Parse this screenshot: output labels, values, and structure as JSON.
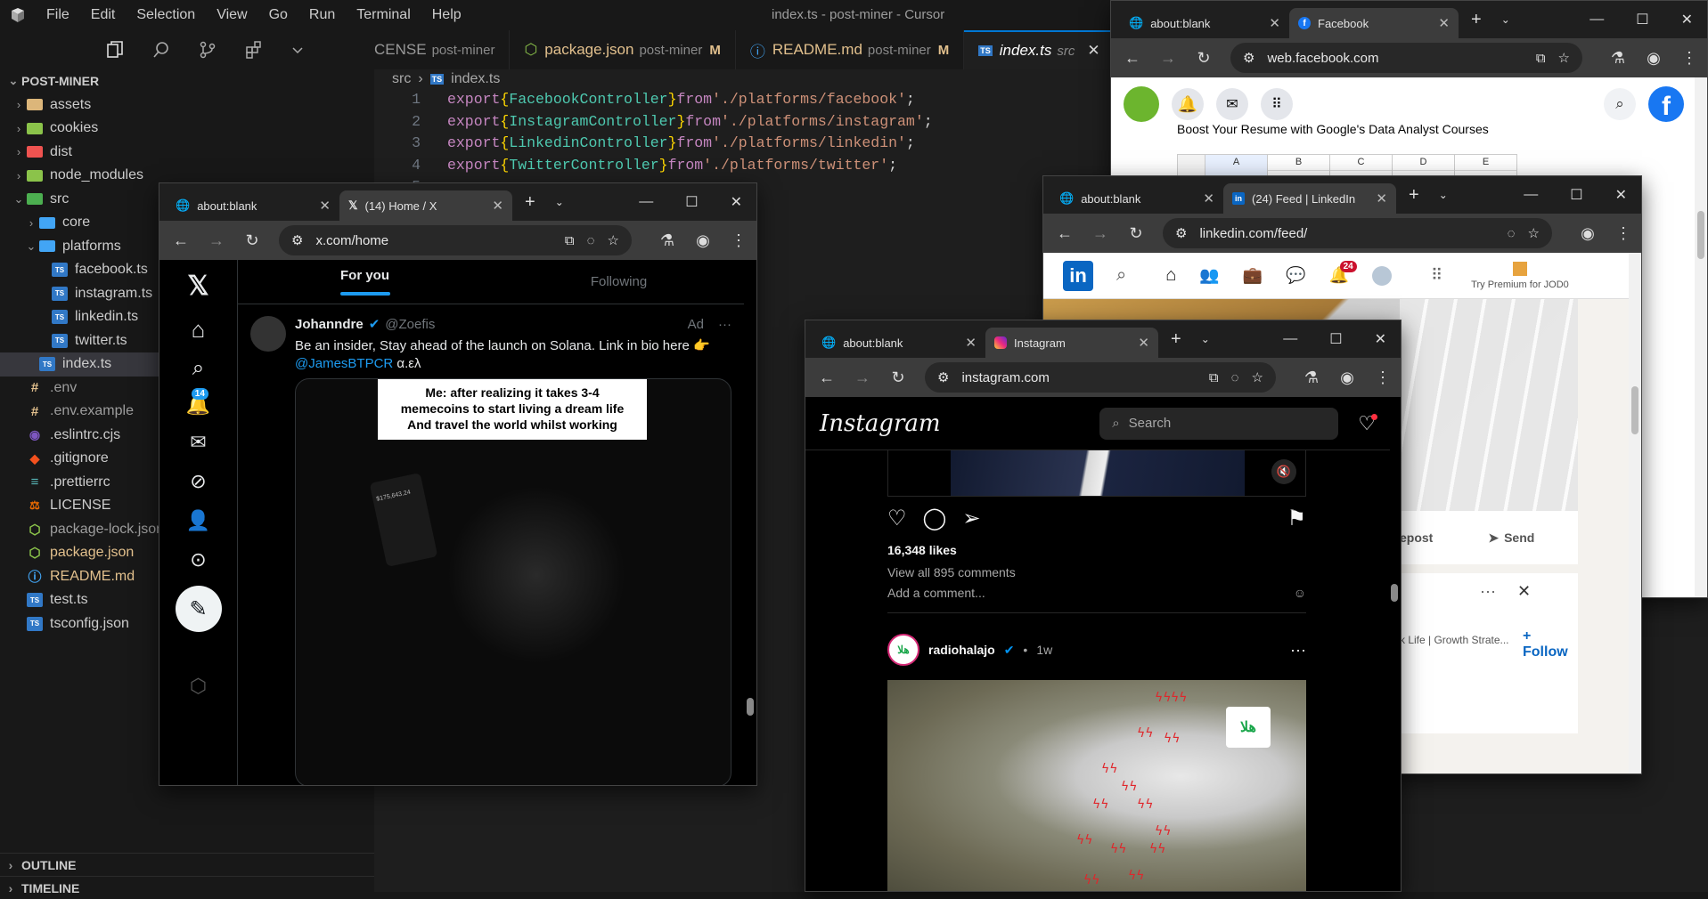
{
  "editor": {
    "menu": [
      "File",
      "Edit",
      "Selection",
      "View",
      "Go",
      "Run",
      "Terminal",
      "Help"
    ],
    "window_title": "index.ts - post-miner - Cursor",
    "explorer_title": "POST-MINER",
    "tree": [
      {
        "label": "assets",
        "type": "folder",
        "color": "#dcb67a",
        "depth": 1
      },
      {
        "label": "cookies",
        "type": "folder",
        "color": "#8bc34a",
        "depth": 1
      },
      {
        "label": "dist",
        "type": "folder",
        "color": "#ef5350",
        "depth": 1
      },
      {
        "label": "node_modules",
        "type": "folder",
        "color": "#8bc34a",
        "depth": 1
      },
      {
        "label": "src",
        "type": "folder-open",
        "color": "#4caf50",
        "depth": 1
      },
      {
        "label": "core",
        "type": "folder",
        "color": "#42a5f5",
        "depth": 2
      },
      {
        "label": "platforms",
        "type": "folder-open",
        "color": "#42a5f5",
        "depth": 2
      },
      {
        "label": "facebook.ts",
        "type": "ts",
        "depth": 3
      },
      {
        "label": "instagram.ts",
        "type": "ts",
        "depth": 3
      },
      {
        "label": "linkedin.ts",
        "type": "ts",
        "depth": 3
      },
      {
        "label": "twitter.ts",
        "type": "ts",
        "depth": 3
      },
      {
        "label": "index.ts",
        "type": "ts",
        "depth": 2,
        "selected": true
      },
      {
        "label": ".env",
        "type": "env",
        "depth": 1
      },
      {
        "label": ".env.example",
        "type": "env",
        "depth": 1
      },
      {
        "label": ".eslintrc.cjs",
        "type": "eslint",
        "depth": 1
      },
      {
        "label": ".gitignore",
        "type": "git",
        "depth": 1
      },
      {
        "label": ".prettierrc",
        "type": "prettier",
        "depth": 1
      },
      {
        "label": "LICENSE",
        "type": "license",
        "depth": 1
      },
      {
        "label": "package-lock.json",
        "type": "npm-dim",
        "depth": 1
      },
      {
        "label": "package.json",
        "type": "npm",
        "depth": 1
      },
      {
        "label": "README.md",
        "type": "info",
        "depth": 1
      },
      {
        "label": "test.ts",
        "type": "ts",
        "depth": 1
      },
      {
        "label": "tsconfig.json",
        "type": "tsconfig",
        "depth": 1
      }
    ],
    "outline_label": "OUTLINE",
    "timeline_label": "TIMELINE",
    "tabs": [
      {
        "name": "CENSE",
        "desc": "post-miner",
        "mod": ""
      },
      {
        "name": "package.json",
        "desc": "post-miner",
        "mod": "M"
      },
      {
        "name": "README.md",
        "desc": "post-miner",
        "mod": "M"
      },
      {
        "name": "index.ts",
        "desc": "src",
        "mod": "",
        "active": true
      }
    ],
    "breadcrumb": [
      "src",
      "index.ts"
    ],
    "code": [
      {
        "n": "1",
        "name": "FacebookController",
        "path": "'./platforms/facebook'"
      },
      {
        "n": "2",
        "name": "InstagramController",
        "path": "'./platforms/instagram'"
      },
      {
        "n": "3",
        "name": "LinkedinController",
        "path": "'./platforms/linkedin'"
      },
      {
        "n": "4",
        "name": "TwitterController",
        "path": "'./platforms/twitter'"
      },
      {
        "n": "5",
        "name": "",
        "path": ""
      }
    ],
    "kw_export": "export",
    "kw_from": "from"
  },
  "facebook": {
    "tab1": "about:blank",
    "tab2": "Facebook",
    "url": "web.facebook.com",
    "ad_text": "Boost Your Resume with Google's Data Analyst Courses",
    "sheet_cols": [
      "A",
      "B",
      "C",
      "D",
      "E"
    ]
  },
  "linkedin": {
    "tab1": "about:blank",
    "tab2": "(24) Feed | LinkedIn",
    "url": "linkedin.com/feed/",
    "notif_count": "24",
    "premium": "Try Premium for JOD0",
    "repost": "epost",
    "send": "Send",
    "follow": "+ Follow",
    "suggest_text": "k Life | Growth Strate..."
  },
  "twitter": {
    "tab1": "about:blank",
    "tab2": "(14) Home / X",
    "url": "x.com/home",
    "tab_for_you": "For you",
    "tab_following": "Following",
    "notif_count": "14",
    "author": "Johanndre",
    "handle": "@Zoefis",
    "ad": "Ad",
    "tweet_text": "Be an insider, Stay ahead of the launch on Solana. Link in bio here 👉",
    "mention": "@JamesBTPCR",
    "mention_tail": "α.ελ",
    "meme_text": "Me: after realizing it takes 3-4 memecoins to start living a dream life And travel the world whilst working",
    "phone_amount": "$175,643.24"
  },
  "instagram": {
    "tab1": "about:blank",
    "tab2": "Instagram",
    "url": "instagram.com",
    "logo": "Instagram",
    "search_placeholder": "Search",
    "likes": "16,348 likes",
    "comments": "View all 895 comments",
    "add_comment": "Add a comment...",
    "account": "radiohalajo",
    "time": "1w",
    "dot": "•"
  },
  "colors": {
    "accent": "#0078d4",
    "ts_blue": "#3178c6",
    "x_blue": "#1d9bf0",
    "fb_blue": "#1877f2",
    "li_blue": "#0a66c2",
    "notif_red": "#f91880"
  }
}
